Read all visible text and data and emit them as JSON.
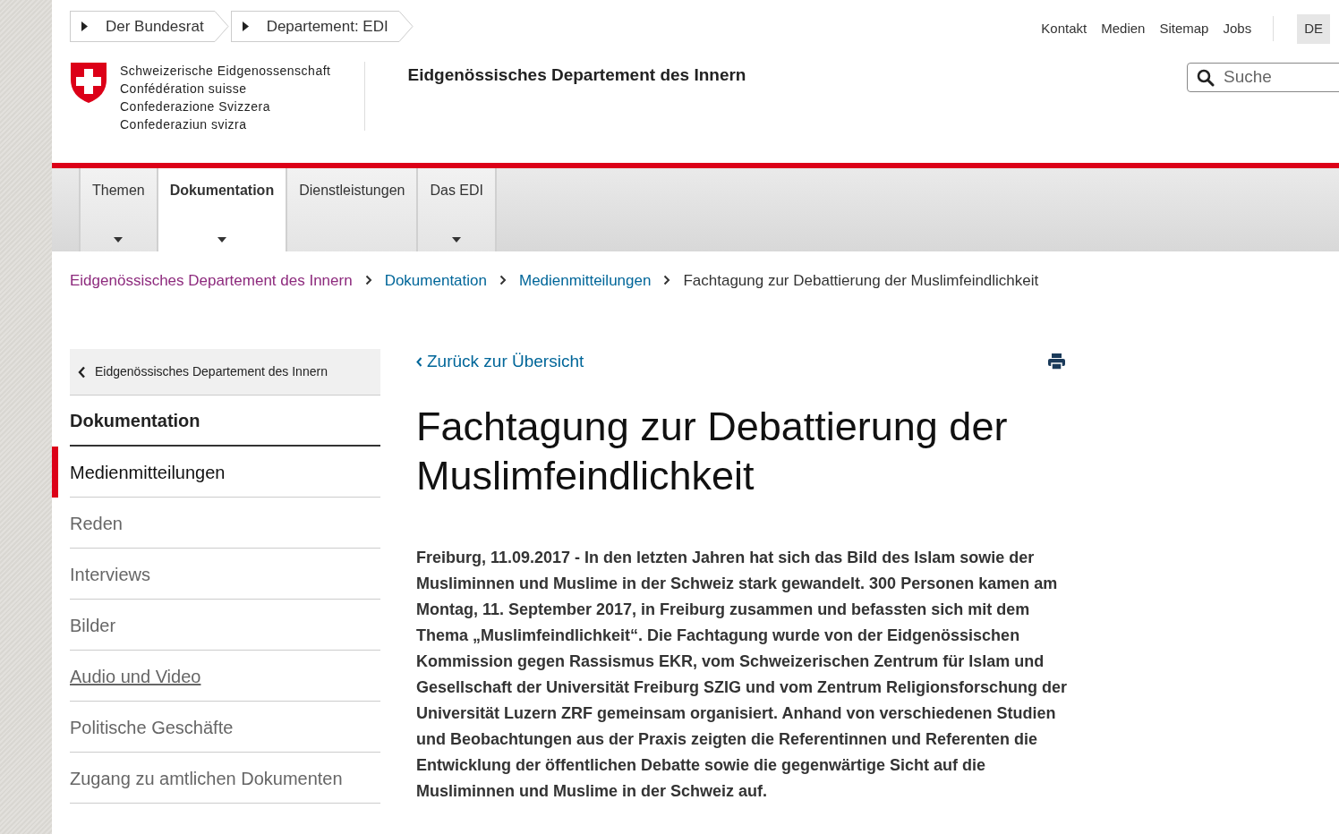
{
  "top_breadcrumb": [
    {
      "label": "Der Bundesrat"
    },
    {
      "label": "Departement: EDI"
    }
  ],
  "top_links": [
    {
      "label": "Kontakt"
    },
    {
      "label": "Medien"
    },
    {
      "label": "Sitemap"
    },
    {
      "label": "Jobs"
    }
  ],
  "language": {
    "label": "DE",
    "selected": true
  },
  "logo": {
    "lines": [
      "Schweizerische Eidgenossenschaft",
      "Confédération suisse",
      "Confederazione Svizzera",
      "Confederaziun svizra"
    ]
  },
  "department_title": "Eidgenössisches Departement des Innern",
  "search": {
    "placeholder": "Suche"
  },
  "main_nav": [
    {
      "label": "Themen",
      "selected": false,
      "has_dropdown": true
    },
    {
      "label": "Dokumentation",
      "selected": true,
      "has_dropdown": true
    },
    {
      "label": "Dienstleistungen",
      "selected": false,
      "has_dropdown": false
    },
    {
      "label": "Das EDI",
      "selected": false,
      "has_dropdown": true
    }
  ],
  "breadcrumb": [
    {
      "label": "Eidgenössisches Departement des Innern",
      "kind": "link",
      "visited": true
    },
    {
      "label": "Dokumentation",
      "kind": "link",
      "visited": false
    },
    {
      "label": "Medienmitteilungen",
      "kind": "link",
      "visited": false
    },
    {
      "label": "Fachtagung zur Debattierung der Muslimfeindlichkeit",
      "kind": "current"
    }
  ],
  "sidebar": {
    "back": "Eidgenössisches Departement des Innern",
    "heading": "Dokumentation",
    "items": [
      {
        "label": "Medienmitteilungen",
        "selected": true,
        "underlined": false
      },
      {
        "label": "Reden",
        "selected": false,
        "underlined": false
      },
      {
        "label": "Interviews",
        "selected": false,
        "underlined": false
      },
      {
        "label": "Bilder",
        "selected": false,
        "underlined": false
      },
      {
        "label": "Audio und Video",
        "selected": false,
        "underlined": true
      },
      {
        "label": "Politische Geschäfte",
        "selected": false,
        "underlined": false
      },
      {
        "label": "Zugang zu amtlichen Dokumenten",
        "selected": false,
        "underlined": false
      }
    ]
  },
  "article": {
    "back_link": "Zurück zur Übersicht",
    "title": "Fachtagung zur Debattierung der Muslimfeindlichkeit",
    "lead": "Freiburg, 11.09.2017 - In den letzten Jahren hat sich das Bild des Islam sowie der Musliminnen und Muslime in der Schweiz stark gewandelt. 300 Personen kamen am Montag, 11. September 2017, in Freiburg zusammen und befassten sich mit dem Thema „Muslimfeindlichkeit“. Die Fachtagung wurde von der Eidgenössischen Kommission gegen Rassismus EKR, vom Schweizerischen Zentrum für Islam und Gesellschaft der Universität Freiburg SZIG und vom Zentrum Religionsforschung der Universität Luzern ZRF gemeinsam organisiert. Anhand von verschiedenen Studien und Beobachtungen aus der Praxis zeigten die Referentinnen und Referenten die Entwicklung der öffentlichen Debatte sowie die gegenwärtige Sicht auf die Musliminnen und Muslime in der Schweiz auf."
  }
}
